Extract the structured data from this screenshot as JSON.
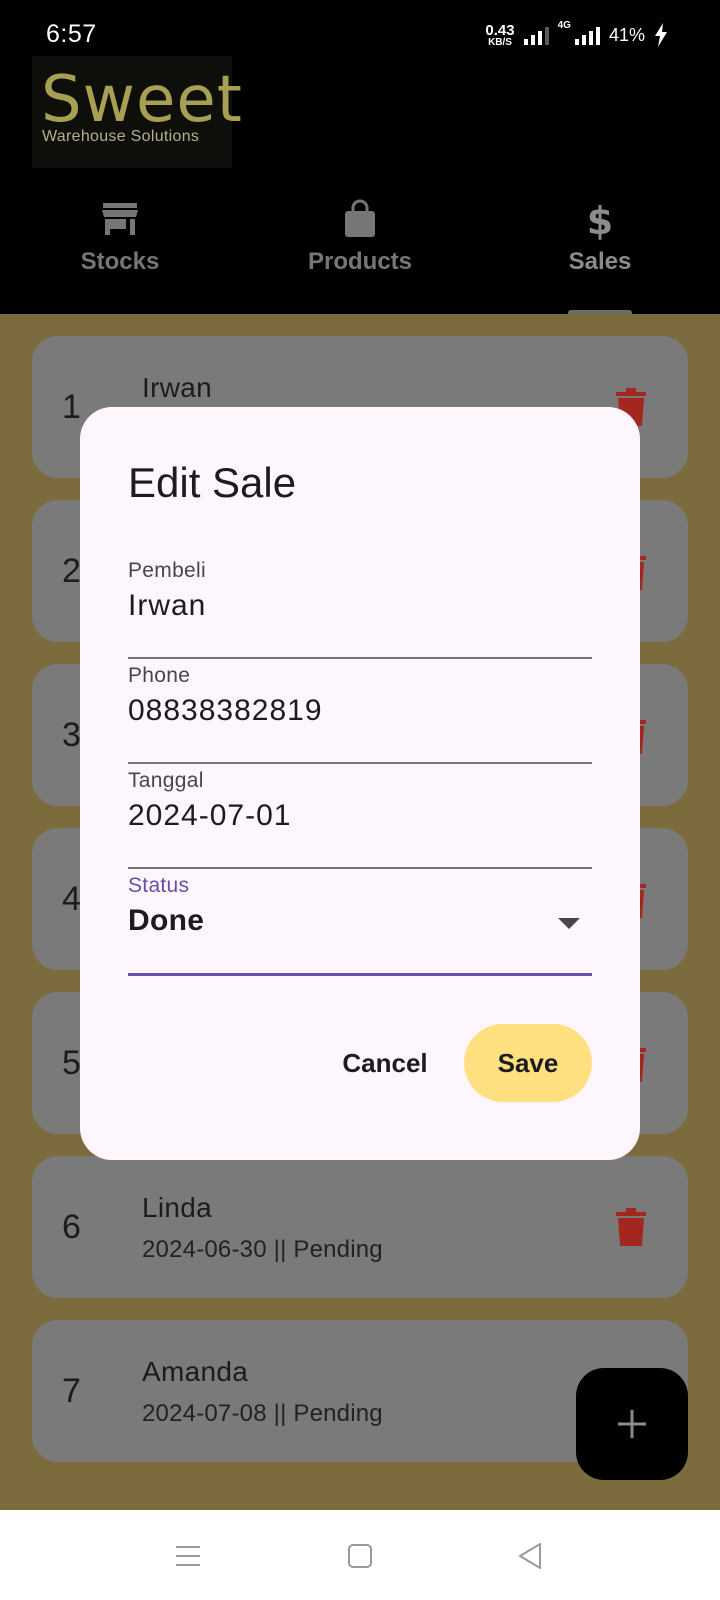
{
  "status_bar": {
    "time": "6:57",
    "net_speed_value": "0.43",
    "net_speed_unit": "KB/S",
    "network_type": "4G",
    "battery": "41%"
  },
  "header": {
    "logo_title": "Sweet",
    "logo_subtitle": "Warehouse Solutions"
  },
  "tabs": [
    {
      "label": "Stocks",
      "icon": "store-icon"
    },
    {
      "label": "Products",
      "icon": "shopping-bag-icon"
    },
    {
      "label": "Sales",
      "icon": "dollar-icon",
      "active": true
    }
  ],
  "sales": [
    {
      "no": "1",
      "name": "Irwan",
      "subtitle": ""
    },
    {
      "no": "2",
      "name": "",
      "subtitle": ""
    },
    {
      "no": "3",
      "name": "",
      "subtitle": ""
    },
    {
      "no": "4",
      "name": "",
      "subtitle": ""
    },
    {
      "no": "5",
      "name": "",
      "subtitle": ""
    },
    {
      "no": "6",
      "name": "Linda",
      "subtitle": "2024-06-30 || Pending"
    },
    {
      "no": "7",
      "name": "Amanda",
      "subtitle": "2024-07-08 || Pending"
    }
  ],
  "dialog": {
    "title": "Edit Sale",
    "fields": {
      "pembeli": {
        "label": "Pembeli",
        "value": "Irwan"
      },
      "phone": {
        "label": "Phone",
        "value": "08838382819"
      },
      "tanggal": {
        "label": "Tanggal",
        "value": "2024-07-01"
      },
      "status": {
        "label": "Status",
        "value": "Done"
      }
    },
    "cancel_label": "Cancel",
    "save_label": "Save"
  },
  "colors": {
    "accent": "#6750a4",
    "save_button": "#ffe080",
    "delete_icon": "#b3261e",
    "logo_gold": "#a7a052"
  }
}
